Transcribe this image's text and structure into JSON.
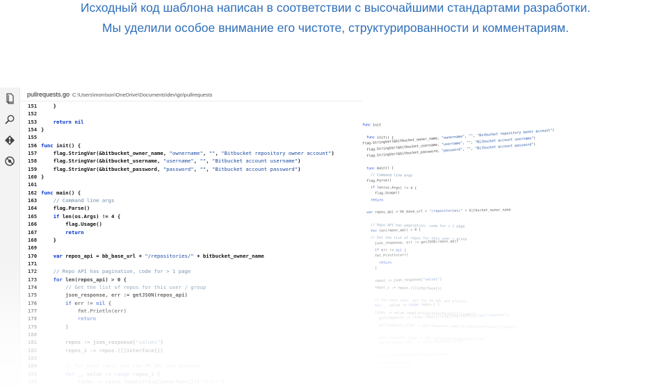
{
  "hero": {
    "line1": "Исходный код шаблона написан в соответствии с высочайшими стандартами разработки.",
    "line2": "Мы уделили особое внимание его чистоте, структурированности и комментариям."
  },
  "activity_bar": {
    "icons": [
      "files-icon",
      "search-icon",
      "git-branch-icon",
      "debug-icon"
    ]
  },
  "editor": {
    "file_name": "pullrequests.go",
    "file_path": "C:\\Users\\morrison\\OneDrive\\Documents\\dev\\go\\pullrequests",
    "lines": [
      {
        "n": "151",
        "t": "    }"
      },
      {
        "n": "152",
        "t": ""
      },
      {
        "n": "153",
        "t": "    return nil"
      },
      {
        "n": "154",
        "t": "}"
      },
      {
        "n": "155",
        "t": ""
      },
      {
        "n": "156",
        "t": "func init() {"
      },
      {
        "n": "157",
        "t": "    flag.StringVar(&bitbucket_owner_name, \"ownername\", \"\", \"Bitbucket repository owner account\")"
      },
      {
        "n": "158",
        "t": "    flag.StringVar(&bitbucket_username, \"username\", \"\", \"Bitbucket account username\")"
      },
      {
        "n": "159",
        "t": "    flag.StringVar(&bitbucket_password, \"password\", \"\", \"Bitbucket account password\")"
      },
      {
        "n": "160",
        "t": "}"
      },
      {
        "n": "161",
        "t": ""
      },
      {
        "n": "162",
        "t": "func main() {"
      },
      {
        "n": "163",
        "t": "    // Command line args"
      },
      {
        "n": "164",
        "t": "    flag.Parse()"
      },
      {
        "n": "165",
        "t": "    if len(os.Args) != 4 {"
      },
      {
        "n": "166",
        "t": "        flag.Usage()"
      },
      {
        "n": "167",
        "t": "        return"
      },
      {
        "n": "168",
        "t": "    }"
      },
      {
        "n": "169",
        "t": ""
      },
      {
        "n": "170",
        "t": "    var repos_api = bb_base_url + \"/repositories/\" + bitbucket_owner_name"
      },
      {
        "n": "171",
        "t": ""
      },
      {
        "n": "172",
        "t": "    // Repo API has pagination, code for > 1 page"
      },
      {
        "n": "173",
        "t": "    for len(repos_api) > 0 {"
      },
      {
        "n": "174",
        "t": "        // Get the list of repos for this user / group"
      },
      {
        "n": "175",
        "t": "        json_response, err := getJSON(repos_api)"
      },
      {
        "n": "176",
        "t": "        if err != nil {"
      },
      {
        "n": "177",
        "t": "            fmt.Println(err)"
      },
      {
        "n": "178",
        "t": "            return"
      },
      {
        "n": "179",
        "t": "        }"
      },
      {
        "n": "180",
        "t": ""
      },
      {
        "n": "181",
        "t": "        repos := json_response[\"values\"]"
      },
      {
        "n": "182",
        "t": "        repos_i := repos.([]interface{})"
      },
      {
        "n": "183",
        "t": ""
      },
      {
        "n": "184",
        "t": "        // For each repo, get the PR URL and process"
      },
      {
        "n": "185",
        "t": "        for _, value := range repos_i {"
      },
      {
        "n": "186",
        "t": "            links := value.(map[string]interface{})[\"links\"]"
      }
    ]
  },
  "minimap": {
    "lines": [
      {
        "t": "func init"
      },
      {
        "t": ""
      },
      {
        "t": "func init() {"
      },
      {
        "t": "flag.StringVar(&bitbucket_owner_name, \"ownername\", \"\", \"Bitbucket repository owner account\")"
      },
      {
        "t": "flag.StringVar(&bitbucket_username, \"username\", \"\", \"Bitbucket account username\")"
      },
      {
        "t": "flag.StringVar(&bitbucket_password, \"password\", \"\", \"Bitbucket account password\")"
      },
      {
        "t": ""
      },
      {
        "t": "func main() {"
      },
      {
        "t": "  // Command line args"
      },
      {
        "t": "  flag.Parse()"
      },
      {
        "t": "  if len(os.Args) != 4 {"
      },
      {
        "t": "    flag.Usage()"
      },
      {
        "t": "    return"
      },
      {
        "t": ""
      },
      {
        "t": "var repos_api = bb_base_url + \"/repositories/\" + bitbucket_owner_name"
      },
      {
        "t": ""
      },
      {
        "t": "  // Repo API has pagination, code for > 1 page"
      },
      {
        "t": "  for len(repos_api) > 0 {"
      },
      {
        "t": "    // Get the list of repos for this user / group"
      },
      {
        "t": "    json_response, err := getJSON(repos_api)"
      },
      {
        "t": "    if err != nil {"
      },
      {
        "t": "      fmt.Println(err)"
      },
      {
        "t": "      return"
      },
      {
        "t": "    }"
      },
      {
        "t": ""
      },
      {
        "t": "    repos := json_response[\"values\"]"
      },
      {
        "t": "    repos_i := repos.([]interface{})"
      },
      {
        "t": ""
      },
      {
        "t": "    // For each repo, get the PR URL and process"
      },
      {
        "t": "    for _, value := range repos_i {"
      },
      {
        "t": "      links := value.(map[string]interface{})[\"links\"]"
      },
      {
        "t": "      pullrequests := links.(map[string]interface{})[\"pullrequests\"]"
      },
      {
        "t": "      pullrequests_href := pullrequests.(map[string]interface{})[\"href\"]"
      },
      {
        "t": ""
      },
      {
        "t": "      pull_requests_link := fmt.Sprint(pullrequests_href)"
      },
      {
        "t": "      fmt.Println(\"URL: \", pull_requests_link)"
      },
      {
        "t": ""
      },
      {
        "t": "      err := listPRs(pull_requests_link)"
      },
      {
        "t": "      if err != nil {"
      },
      {
        "t": "        fmt.Println(err)"
      }
    ]
  },
  "colors": {
    "hero_text": "#2f6fba",
    "keyword": "#0033cc",
    "string": "#1a4a9f",
    "comment": "#6b8aa8"
  }
}
